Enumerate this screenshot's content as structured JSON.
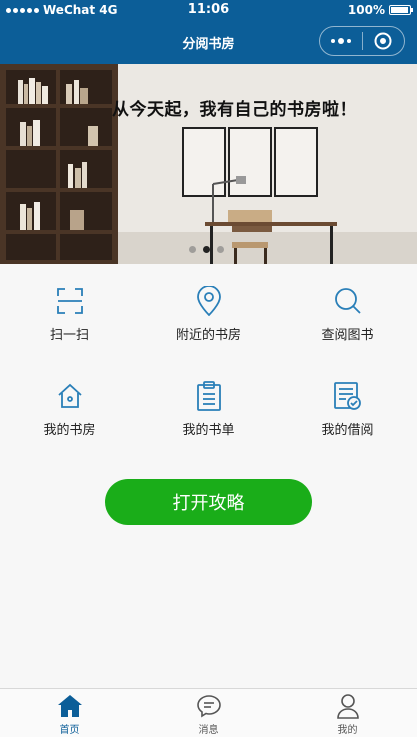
{
  "status_bar": {
    "carrier": "WeChat 4G",
    "time": "11:06",
    "battery": "100%"
  },
  "nav": {
    "title": "分阅书房"
  },
  "banner": {
    "slogan": "从今天起，我有自己的书房啦！",
    "slide_count": 3,
    "active_slide": 1
  },
  "grid": [
    {
      "label": "扫一扫",
      "icon": "scan-icon"
    },
    {
      "label": "附近的书房",
      "icon": "location-pin-icon"
    },
    {
      "label": "查阅图书",
      "icon": "search-icon"
    },
    {
      "label": "我的书房",
      "icon": "house-icon"
    },
    {
      "label": "我的书单",
      "icon": "clipboard-list-icon"
    },
    {
      "label": "我的借阅",
      "icon": "borrow-record-icon"
    }
  ],
  "guide_button": {
    "label": "打开攻略"
  },
  "tabbar": [
    {
      "label": "首页",
      "icon": "home-icon",
      "active": true
    },
    {
      "label": "消息",
      "icon": "message-icon",
      "active": false
    },
    {
      "label": "我的",
      "icon": "user-icon",
      "active": false
    }
  ],
  "colors": {
    "primary": "#0c5e98",
    "accent_green": "#1aad19",
    "icon_blue": "#2a7fb8"
  }
}
